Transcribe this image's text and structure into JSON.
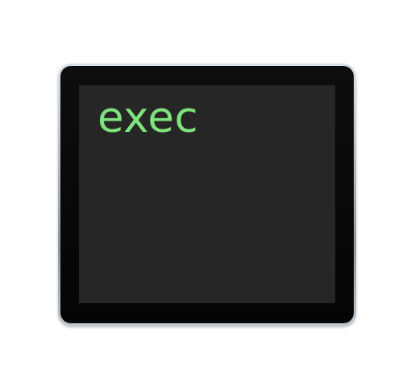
{
  "icon": {
    "name": "terminal-icon",
    "screen_text": "exec",
    "text_color": "#7ee37a",
    "screen_color": "#262626",
    "bezel_color": "#0a0a0a",
    "frame_color": "#b9c3ca"
  }
}
